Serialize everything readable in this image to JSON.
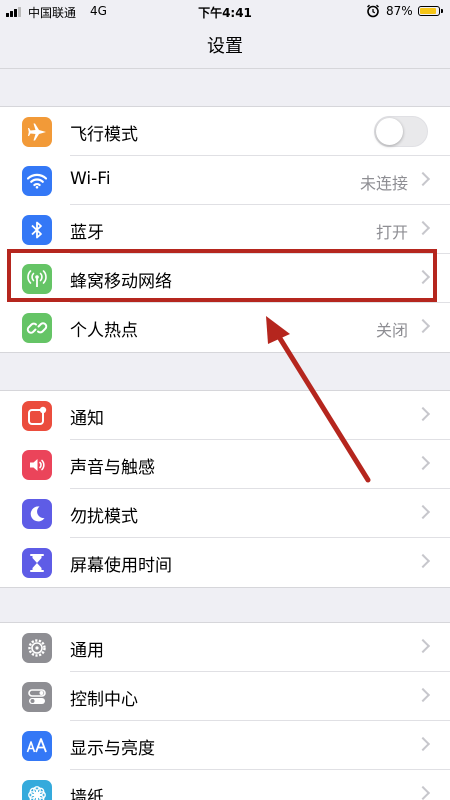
{
  "status_bar": {
    "carrier": "中国联通",
    "network": "4G",
    "time": "下午4:41",
    "battery_percent": "87%",
    "battery_level": 0.87
  },
  "nav": {
    "title": "设置"
  },
  "groups": [
    {
      "rows": [
        {
          "label": "飞行模式",
          "icon": "airplane-icon",
          "color": "#f29a38",
          "control": "toggle",
          "toggle_on": false
        },
        {
          "label": "Wi-Fi",
          "icon": "wifi-icon",
          "color": "#3478f6",
          "value": "未连接"
        },
        {
          "label": "蓝牙",
          "icon": "bluetooth-icon",
          "color": "#3478f6",
          "value": "打开"
        },
        {
          "label": "蜂窝移动网络",
          "icon": "cellular-antenna-icon",
          "color": "#65c466",
          "highlighted": true
        },
        {
          "label": "个人热点",
          "icon": "hotspot-link-icon",
          "color": "#65c466",
          "value": "关闭"
        }
      ]
    },
    {
      "rows": [
        {
          "label": "通知",
          "icon": "notification-icon",
          "color": "#eb4d3d"
        },
        {
          "label": "声音与触感",
          "icon": "speaker-icon",
          "color": "#eb445a"
        },
        {
          "label": "勿扰模式",
          "icon": "moon-icon",
          "color": "#5e5ce6"
        },
        {
          "label": "屏幕使用时间",
          "icon": "hourglass-icon",
          "color": "#5e5ce6"
        }
      ]
    },
    {
      "rows": [
        {
          "label": "通用",
          "icon": "gear-icon",
          "color": "#8e8e93"
        },
        {
          "label": "控制中心",
          "icon": "switches-icon",
          "color": "#8e8e93"
        },
        {
          "label": "显示与亮度",
          "icon": "text-size-icon",
          "color": "#3478f6"
        },
        {
          "label": "墙纸",
          "icon": "flower-icon",
          "color": "#35aadc"
        }
      ]
    }
  ],
  "annotation": {
    "box_color": "#b5261e",
    "arrow_color": "#b5261e"
  }
}
